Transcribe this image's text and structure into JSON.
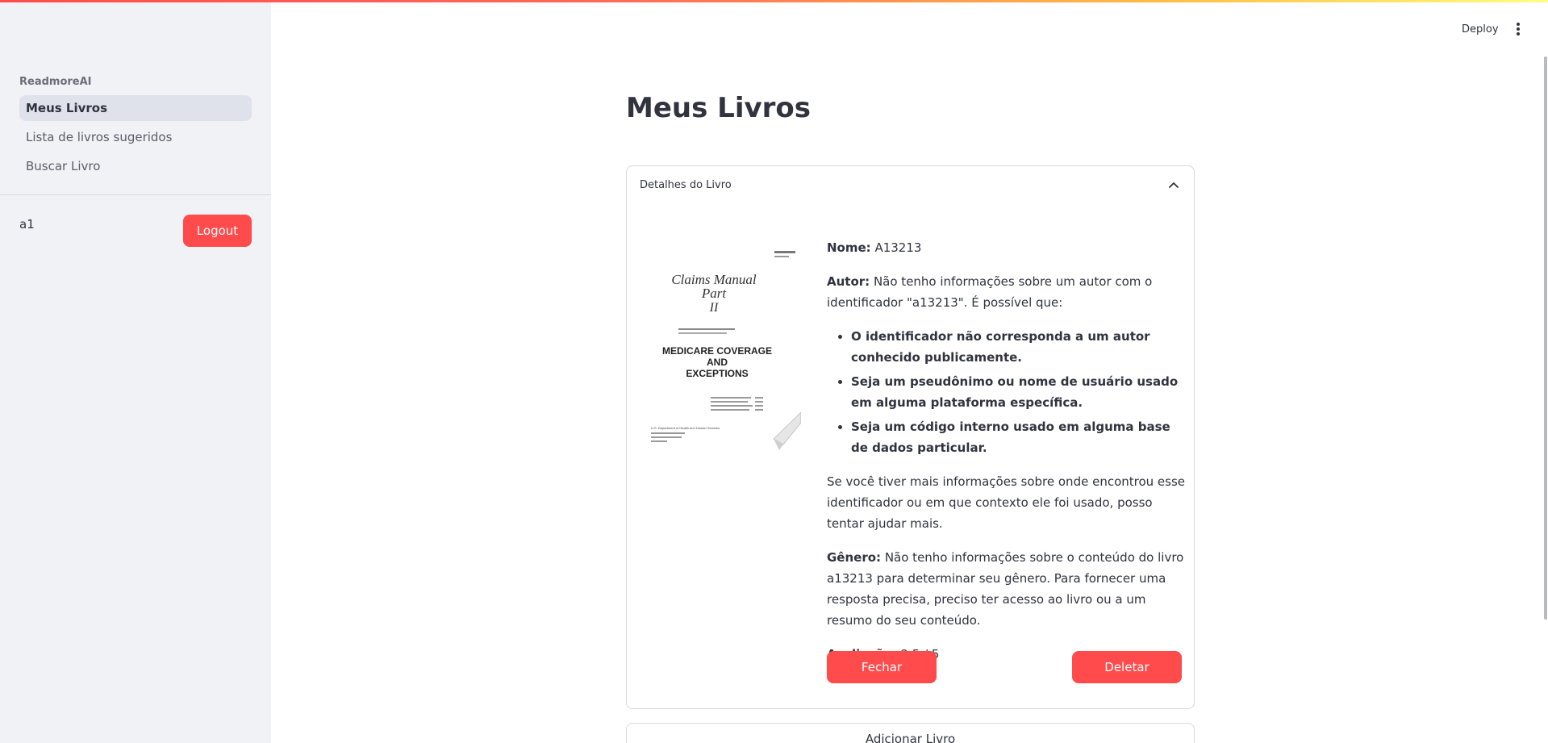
{
  "header": {
    "deploy_label": "Deploy"
  },
  "sidebar": {
    "app_name": "ReadmoreAI",
    "items": [
      {
        "label": "Meus Livros",
        "active": true
      },
      {
        "label": "Lista de livros sugeridos",
        "active": false
      },
      {
        "label": "Buscar Livro",
        "active": false
      }
    ],
    "user": "a1",
    "logout_label": "Logout"
  },
  "main": {
    "title": "Meus Livros",
    "expander": {
      "header": "Detalhes do Livro",
      "cover": {
        "line1": "Claims Manual",
        "line2": "Part",
        "line3": "II",
        "line4": "MEDICARE COVERAGE",
        "line5": "AND",
        "line6": "EXCEPTIONS",
        "footer": "U.S. Department of Health and Human Services"
      },
      "name_label": "Nome:",
      "name_value": "A13213",
      "author_label": "Autor:",
      "author_text": "Não tenho informações sobre um autor com o identificador \"a13213\". É possível que:",
      "author_bullets": [
        "O identificador não corresponda a um autor conhecido publicamente.",
        "Seja um pseudônimo ou nome de usuário usado em alguma plataforma específica.",
        "Seja um código interno usado em alguma base de dados particular."
      ],
      "author_followup": "Se você tiver mais informações sobre onde encontrou esse identificador ou em que contexto ele foi usado, posso tentar ajudar mais.",
      "genre_label": "Gênero:",
      "genre_text": "Não tenho informações sobre o conteúdo do livro a13213 para determinar seu gênero. Para fornecer uma resposta precisa, preciso ter acesso ao livro ou a um resumo do seu conteúdo.",
      "rating_label": "Avaliação:",
      "rating_value": "2.5 / 5",
      "close_label": "Fechar",
      "delete_label": "Deletar"
    },
    "add_book_label": "Adicionar Livro"
  }
}
